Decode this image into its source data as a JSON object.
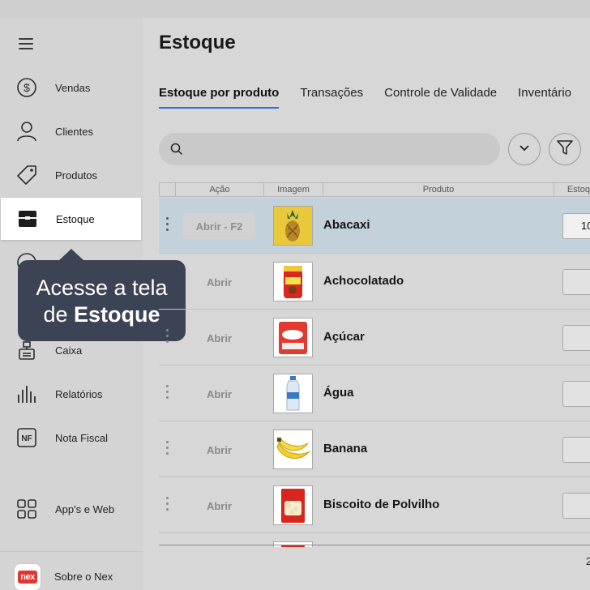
{
  "sidebar": {
    "items": [
      {
        "label": "Vendas",
        "icon": "dollar-circle-icon"
      },
      {
        "label": "Clientes",
        "icon": "user-icon"
      },
      {
        "label": "Produtos",
        "icon": "tag-icon"
      },
      {
        "label": "Estoque",
        "icon": "box-icon"
      },
      {
        "label": "Caixa",
        "icon": "cash-register-icon"
      },
      {
        "label": "Relatórios",
        "icon": "bar-chart-icon"
      },
      {
        "label": "Nota Fiscal",
        "icon": "nf-icon"
      },
      {
        "label": "App's e Web",
        "icon": "apps-grid-icon"
      },
      {
        "label": "Sobre o Nex",
        "icon": "nex-logo-icon"
      }
    ],
    "logo_text": "nex"
  },
  "tooltip": {
    "line1": "Acesse a tela",
    "line2_prefix": "de ",
    "line2_bold": "Estoque"
  },
  "main": {
    "title": "Estoque",
    "tabs": [
      "Estoque por produto",
      "Transações",
      "Controle de Validade",
      "Inventário"
    ],
    "search": {
      "placeholder": "",
      "value": ""
    },
    "table": {
      "headers": [
        "Ação",
        "Imagem",
        "Produto",
        "Estoque"
      ],
      "rows": [
        {
          "action": "Abrir - F2",
          "product": "Abacaxi",
          "stock": "10"
        },
        {
          "action": "Abrir",
          "product": "Achocolatado",
          "stock": ""
        },
        {
          "action": "Abrir",
          "product": "Açúcar",
          "stock": ""
        },
        {
          "action": "Abrir",
          "product": "Água",
          "stock": ""
        },
        {
          "action": "Abrir",
          "product": "Banana",
          "stock": ""
        },
        {
          "action": "Abrir",
          "product": "Biscoito de Polvilho",
          "stock": ""
        }
      ]
    },
    "footer_count": "2"
  },
  "colors": {
    "accent": "#2d6fd6",
    "tooltip_bg": "#3b4354",
    "selected_row": "#c3d1db",
    "brand_red": "#e3362f"
  }
}
